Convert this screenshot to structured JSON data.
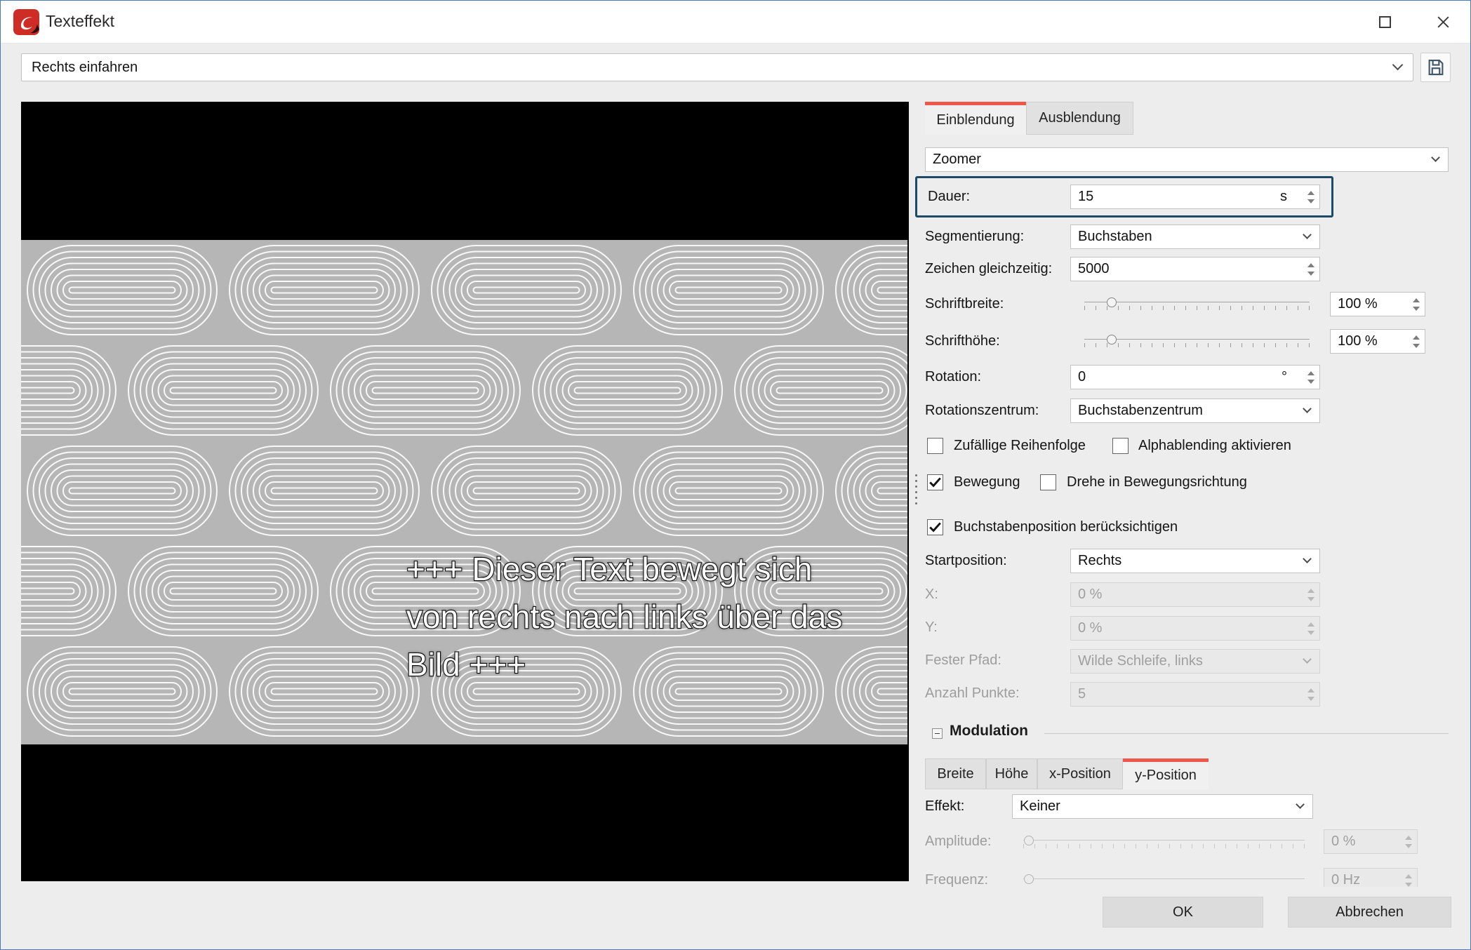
{
  "window": {
    "title": "Texteffekt"
  },
  "titlebar_icons": {
    "maximize": "square-outline",
    "close": "x-glyph",
    "app": "aquasoft-logo"
  },
  "preset": {
    "value": "Rechts einfahren",
    "save_icon": "floppy-disk"
  },
  "preview": {
    "line1": "+++ Dieser Text bewegt sich",
    "line2": "von rechts nach links über das",
    "line3": "Bild +++"
  },
  "tabs": {
    "einblendung": "Einblendung",
    "ausblendung": "Ausblendung",
    "active": "Einblendung"
  },
  "effect_select": {
    "value": "Zoomer"
  },
  "dauer": {
    "label": "Dauer:",
    "value": "15",
    "unit": "s"
  },
  "segmentierung": {
    "label": "Segmentierung:",
    "value": "Buchstaben"
  },
  "zeichen": {
    "label": "Zeichen gleichzeitig:",
    "value": "5000"
  },
  "schriftbreite": {
    "label": "Schriftbreite:",
    "value": "100 %",
    "slider_percent": 12
  },
  "schrifthoehe": {
    "label": "Schrifthöhe:",
    "value": "100 %",
    "slider_percent": 12
  },
  "rotation": {
    "label": "Rotation:",
    "value": "0",
    "unit": "°"
  },
  "rotationszentrum": {
    "label": "Rotationszentrum:",
    "value": "Buchstabenzentrum"
  },
  "checks": {
    "zufaellig": {
      "label": "Zufällige Reihenfolge",
      "checked": false
    },
    "alpha": {
      "label": "Alphablending aktivieren",
      "checked": false
    },
    "bewegung": {
      "label": "Bewegung",
      "checked": true
    },
    "drehe": {
      "label": "Drehe in Bewegungsrichtung",
      "checked": false
    },
    "buchstabenpos": {
      "label": "Buchstabenposition berücksichtigen",
      "checked": true
    }
  },
  "startposition": {
    "label": "Startposition:",
    "value": "Rechts"
  },
  "posx": {
    "label": "X:",
    "value": "0 %",
    "disabled": true
  },
  "posy": {
    "label": "Y:",
    "value": "0 %",
    "disabled": true
  },
  "festerpfad": {
    "label": "Fester Pfad:",
    "value": "Wilde Schleife, links",
    "disabled": true
  },
  "anzahlpunkte": {
    "label": "Anzahl Punkte:",
    "value": "5",
    "disabled": true
  },
  "modulation": {
    "title": "Modulation",
    "tabs": {
      "breite": "Breite",
      "hoehe": "Höhe",
      "xpos": "x-Position",
      "ypos": "y-Position",
      "active": "y-Position"
    },
    "effekt": {
      "label": "Effekt:",
      "value": "Keiner"
    },
    "amplitude": {
      "label": "Amplitude:",
      "value": "0 %",
      "slider_percent": 2,
      "disabled": true
    },
    "frequenz": {
      "label": "Frequenz:",
      "value": "0 Hz",
      "slider_percent": 2,
      "disabled": true
    }
  },
  "buttons": {
    "ok": "OK",
    "cancel": "Abbrechen"
  },
  "colors": {
    "accent_red": "#ee574b",
    "highlight_border": "#1d4a66",
    "preview_pattern_bg": "#b6b6b6",
    "pattern_ring": "#f8f8f8"
  }
}
